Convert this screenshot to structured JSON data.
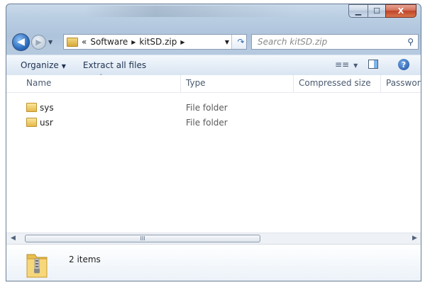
{
  "window": {
    "minimize_glyph": "▁",
    "maximize_glyph": "☐",
    "close_glyph": "X"
  },
  "navigation": {
    "back_icon": "arrow-left-icon",
    "forward_icon": "arrow-right-icon"
  },
  "address_bar": {
    "overflow": "«",
    "crumbs": [
      "Software",
      "kitSD.zip"
    ]
  },
  "search": {
    "placeholder": "Search kitSD.zip"
  },
  "toolbar": {
    "organize_label": "Organize",
    "extract_label": "Extract all files"
  },
  "columns": {
    "name": "Name",
    "type": "Type",
    "compressed_size": "Compressed size",
    "password": "Password"
  },
  "files": [
    {
      "name": "sys",
      "type": "File folder"
    },
    {
      "name": "usr",
      "type": "File folder"
    }
  ],
  "scrollbar": {
    "grip": "III"
  },
  "details_pane": {
    "item_count": "2 items"
  },
  "colors": {
    "accent": "#2d6fc1",
    "close_button": "#c0432a",
    "folder": "#e5b94c"
  }
}
